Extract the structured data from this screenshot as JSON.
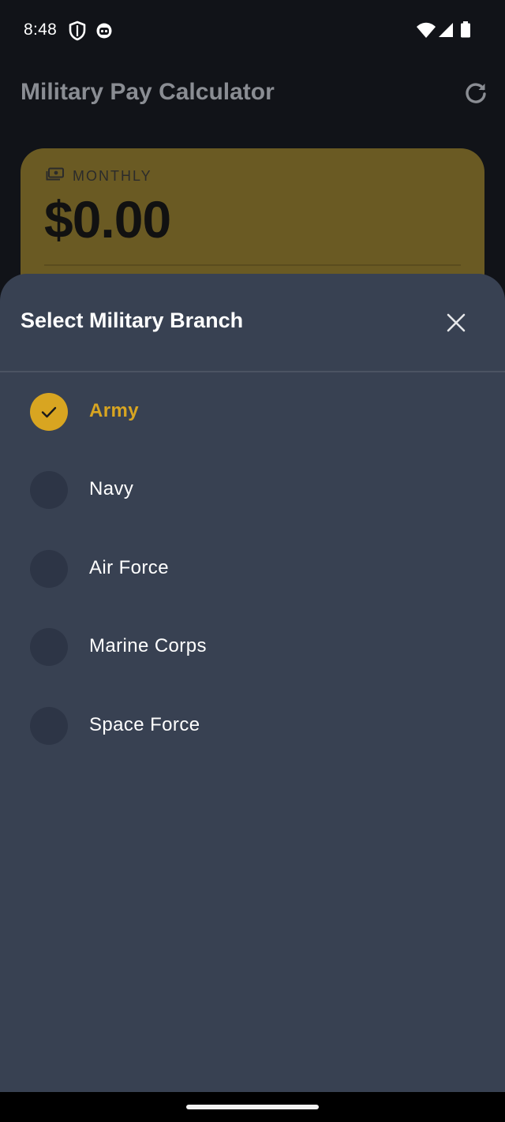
{
  "status_bar": {
    "time": "8:48",
    "icons": [
      "shield-icon",
      "robot-face-icon",
      "wifi-icon",
      "cellular-signal-icon",
      "battery-icon"
    ]
  },
  "app_bar": {
    "title": "Military Pay Calculator",
    "refresh_icon": "refresh-icon"
  },
  "pay_card": {
    "label": "MONTHLY",
    "icon": "cash-icon",
    "amount": "$0.00",
    "color": "#6a5a23"
  },
  "sheet": {
    "title": "Select Military Branch",
    "close_icon": "close-icon",
    "options": [
      {
        "label": "Army",
        "selected": true
      },
      {
        "label": "Navy",
        "selected": false
      },
      {
        "label": "Air Force",
        "selected": false
      },
      {
        "label": "Marine Corps",
        "selected": false
      },
      {
        "label": "Space Force",
        "selected": false
      }
    ]
  },
  "colors": {
    "accent": "#d8a521",
    "sheet_background": "#384152",
    "unselected_circle": "#2d3546"
  }
}
